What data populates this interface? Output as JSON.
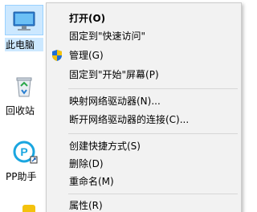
{
  "desktop": {
    "icons": [
      {
        "label": "此电脑",
        "icon": "computer-icon"
      },
      {
        "label": "回收站",
        "icon": "recycle-bin-icon"
      },
      {
        "label": "PP助手",
        "icon": "pp-assistant-icon"
      }
    ]
  },
  "context_menu": {
    "items": [
      {
        "label": "打开(O)",
        "bold": true
      },
      {
        "label": "固定到\"快速访问\""
      },
      {
        "label": "管理(G)",
        "icon": "shield-icon"
      },
      {
        "label": "固定到\"开始\"屏幕(P)"
      },
      {
        "label": "映射网络驱动器(N)..."
      },
      {
        "label": "断开网络驱动器的连接(C)..."
      },
      {
        "label": "创建快捷方式(S)"
      },
      {
        "label": "删除(D)"
      },
      {
        "label": "重命名(M)"
      },
      {
        "label": "属性(R)"
      }
    ]
  },
  "colors": {
    "menu_background": "#f2f2f2",
    "selection": "#cce8ff",
    "shield_blue": "#1f6fd6",
    "shield_yellow": "#f4c20d"
  }
}
